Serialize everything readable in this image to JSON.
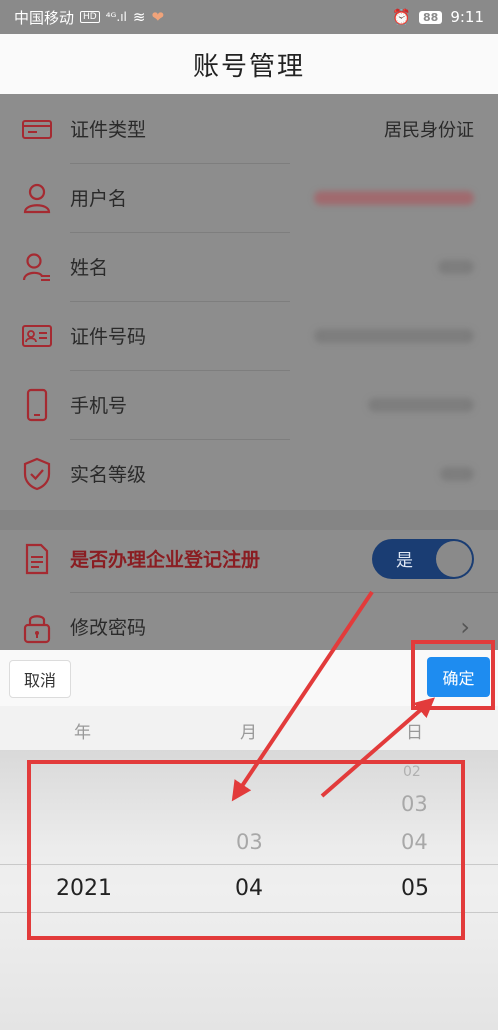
{
  "status": {
    "carrier": "中国移动",
    "hd": "HD",
    "signal": "⁴ᴳ.ıl",
    "wifi": "≋",
    "battery": "88",
    "time": "9:11"
  },
  "header": {
    "title": "账号管理"
  },
  "rows": [
    {
      "label": "证件类型",
      "value": "居民身份证"
    },
    {
      "label": "用户名"
    },
    {
      "label": "姓名"
    },
    {
      "label": "证件号码"
    },
    {
      "label": "手机号"
    },
    {
      "label": "实名等级"
    }
  ],
  "enterprise": {
    "label": "是否办理企业登记注册",
    "toggle_label": "是"
  },
  "password": {
    "label": "修改密码",
    "chevron": "›"
  },
  "picker": {
    "cancel_label": "取消",
    "ok_label": "确定",
    "columns": [
      "年",
      "月",
      "日"
    ],
    "year": {
      "selected": "2021"
    },
    "month": {
      "above": "03",
      "selected": "04"
    },
    "day": {
      "above3": "02",
      "above2": "03",
      "above1": "04",
      "selected": "05"
    }
  },
  "colors": {
    "accent_red": "#b0242c",
    "ok_blue": "#1e8cf0",
    "toggle_navy": "#1a3d73"
  }
}
